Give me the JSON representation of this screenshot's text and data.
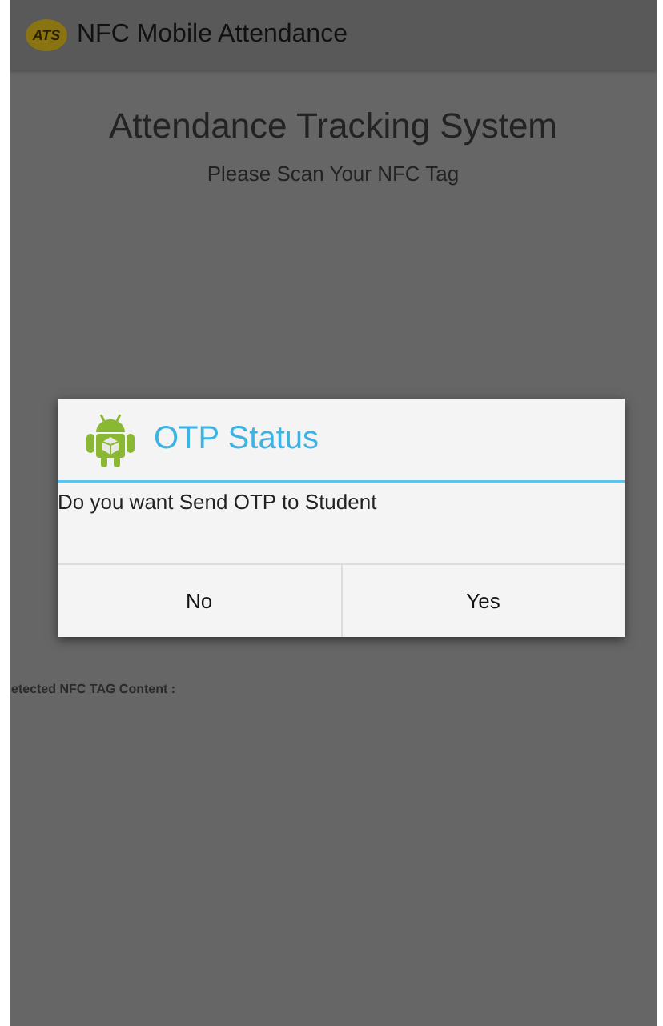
{
  "action_bar": {
    "logo": "ATS",
    "title": "NFC Mobile Attendance"
  },
  "main": {
    "heading": "Attendance Tracking System",
    "subheading": "Please Scan Your NFC Tag",
    "tag_label": "etected NFC TAG Content :"
  },
  "dialog": {
    "title": "OTP Status",
    "message": "Do you want Send OTP to Student",
    "buttons": [
      {
        "label": "No"
      },
      {
        "label": "Yes"
      }
    ]
  }
}
